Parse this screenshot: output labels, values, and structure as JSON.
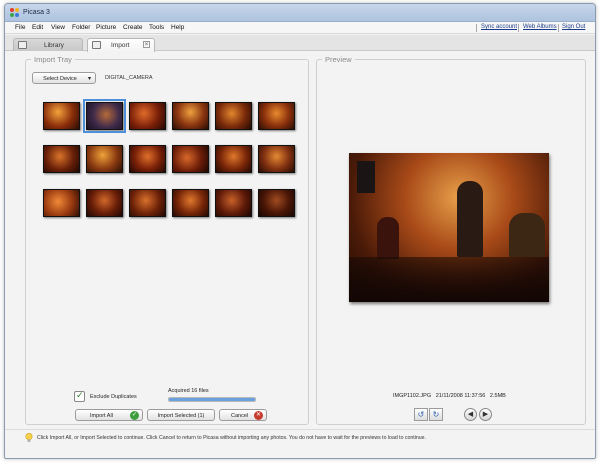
{
  "window": {
    "title": "Picasa 3"
  },
  "menu": {
    "items": [
      "File",
      "Edit",
      "View",
      "Folder",
      "Picture",
      "Create",
      "Tools",
      "Help"
    ],
    "links": [
      "Sync account",
      "Web Albums",
      "Sign Out"
    ]
  },
  "tabs": [
    {
      "label": "Library"
    },
    {
      "label": "Import"
    }
  ],
  "import_tray": {
    "legend": "Import Tray",
    "select_device_label": "Select Device",
    "device_name": "DIGITAL_CAMERA",
    "exclude_duplicates_label": "Exclude Duplicates",
    "acquired_text": "Acquired 16 files",
    "progress": 1.0,
    "buttons": {
      "import_all": "Import All",
      "import_selected": "Import Selected (1)",
      "cancel": "Cancel"
    }
  },
  "preview": {
    "legend": "Preview",
    "file_info": "IMGP1102.JPG   21/11/2008 11:37:56   2.5MB"
  },
  "status": {
    "text": "Click Import All, or Import Selected to continue. Click Cancel to return to Picasa without importing any photos. You do not have to wait for the previews to load to continue."
  },
  "colors": {
    "accent": "#4d8fd9",
    "ok_icon": "#3e9e3e",
    "cancel_icon": "#c83a2c"
  },
  "icons": {
    "check": "✓",
    "cancel": "✕",
    "rotate_left": "↺",
    "rotate_right": "↻",
    "prev": "◀",
    "next": "▶",
    "close": "×",
    "dropdown": "▾"
  }
}
